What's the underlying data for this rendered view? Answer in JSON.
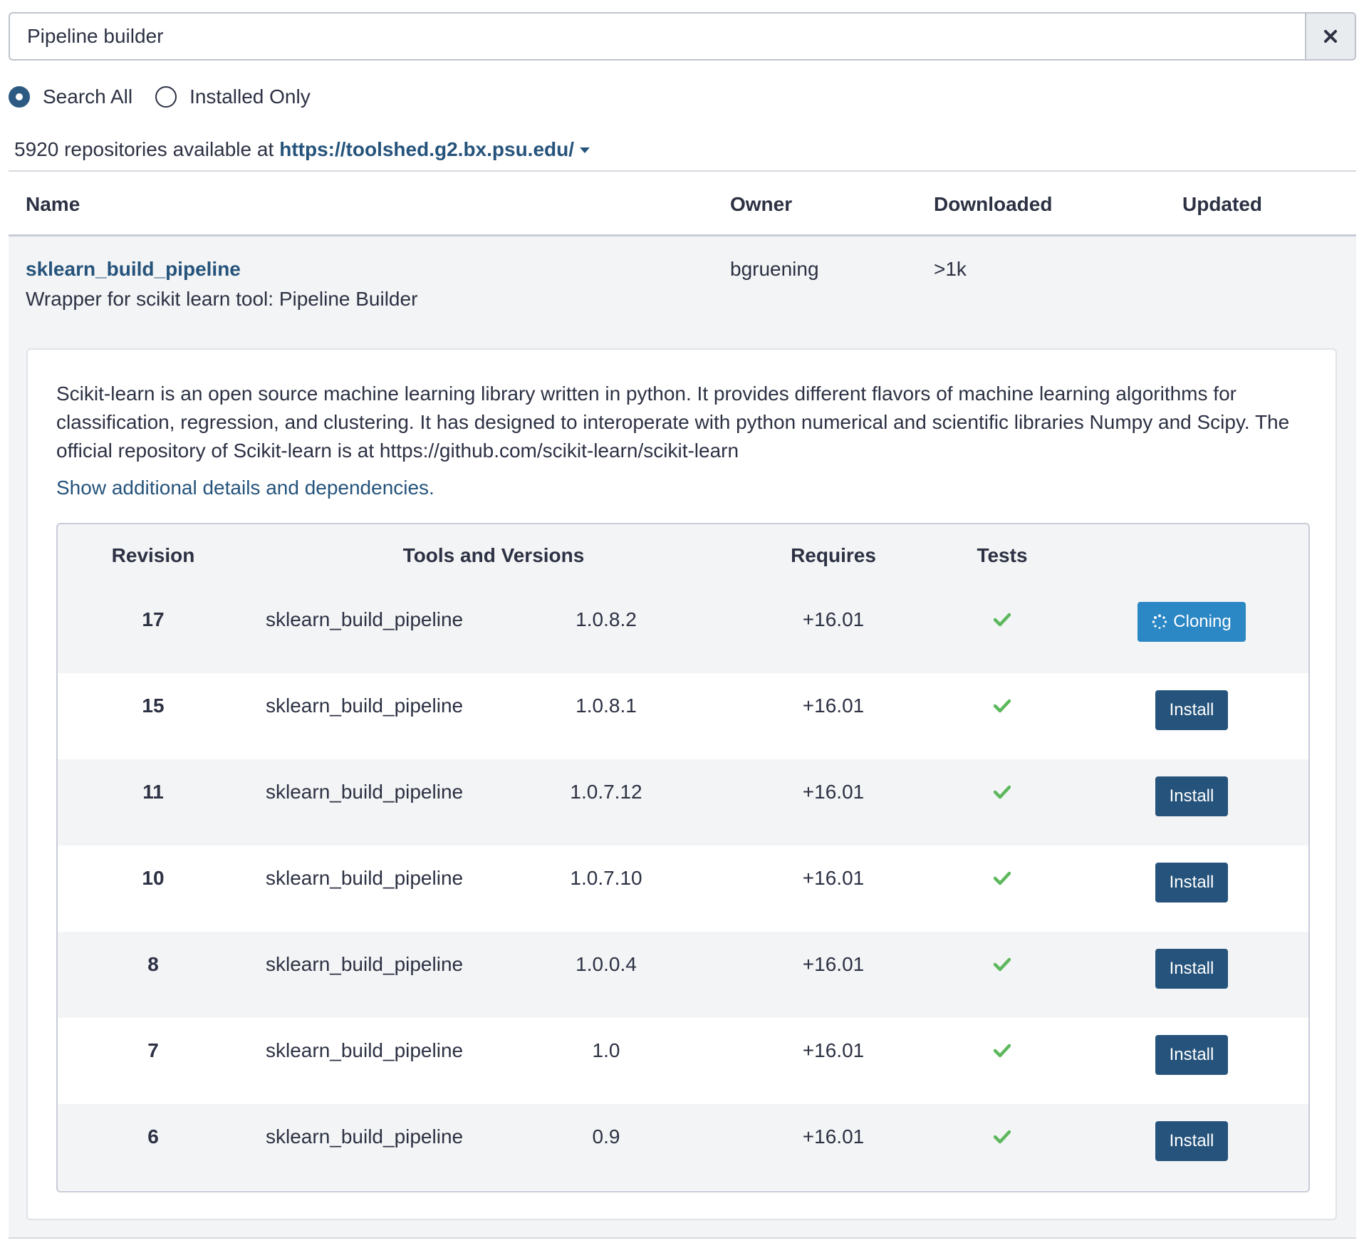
{
  "search": {
    "value": "Pipeline builder",
    "placeholder": ""
  },
  "filters": [
    {
      "label": "Search All",
      "checked": true
    },
    {
      "label": "Installed Only",
      "checked": false
    }
  ],
  "summary": {
    "text": "5920 repositories available at",
    "url": "https://toolshed.g2.bx.psu.edu/"
  },
  "columns": {
    "name": "Name",
    "owner": "Owner",
    "downloaded": "Downloaded",
    "updated": "Updated"
  },
  "repository": {
    "name": "sklearn_build_pipeline",
    "description": "Wrapper for scikit learn tool: Pipeline Builder",
    "owner": "bgruening",
    "downloaded": ">1k",
    "long_description": "Scikit-learn is an open source machine learning library written in python. It provides different flavors of machine learning algorithms for classification, regression, and clustering. It has designed to interoperate with python numerical and scientific libraries Numpy and Scipy. The official repository of Scikit-learn is at https://github.com/scikit-learn/scikit-learn",
    "details_link": "Show additional details and dependencies."
  },
  "revisions": {
    "headers": {
      "revision": "Revision",
      "tools": "Tools and Versions",
      "requires": "Requires",
      "tests": "Tests"
    },
    "rows": [
      {
        "revision": "17",
        "tool": "sklearn_build_pipeline",
        "version": "1.0.8.2",
        "requires": "+16.01",
        "action": "Cloning"
      },
      {
        "revision": "15",
        "tool": "sklearn_build_pipeline",
        "version": "1.0.8.1",
        "requires": "+16.01",
        "action": "Install"
      },
      {
        "revision": "11",
        "tool": "sklearn_build_pipeline",
        "version": "1.0.7.12",
        "requires": "+16.01",
        "action": "Install"
      },
      {
        "revision": "10",
        "tool": "sklearn_build_pipeline",
        "version": "1.0.7.10",
        "requires": "+16.01",
        "action": "Install"
      },
      {
        "revision": "8",
        "tool": "sklearn_build_pipeline",
        "version": "1.0.0.4",
        "requires": "+16.01",
        "action": "Install"
      },
      {
        "revision": "7",
        "tool": "sklearn_build_pipeline",
        "version": "1.0",
        "requires": "+16.01",
        "action": "Install"
      },
      {
        "revision": "6",
        "tool": "sklearn_build_pipeline",
        "version": "0.9",
        "requires": "+16.01",
        "action": "Install"
      }
    ]
  },
  "colors": {
    "primary": "#25537b",
    "cloning": "#2c87c5",
    "check": "#5cb85c",
    "row_alt": "#f3f4f5"
  },
  "icons": {
    "clear": "close-icon",
    "tests_pass": "checkmark-icon",
    "cloning": "spinner-icon",
    "dropdown": "caret-down-icon"
  }
}
